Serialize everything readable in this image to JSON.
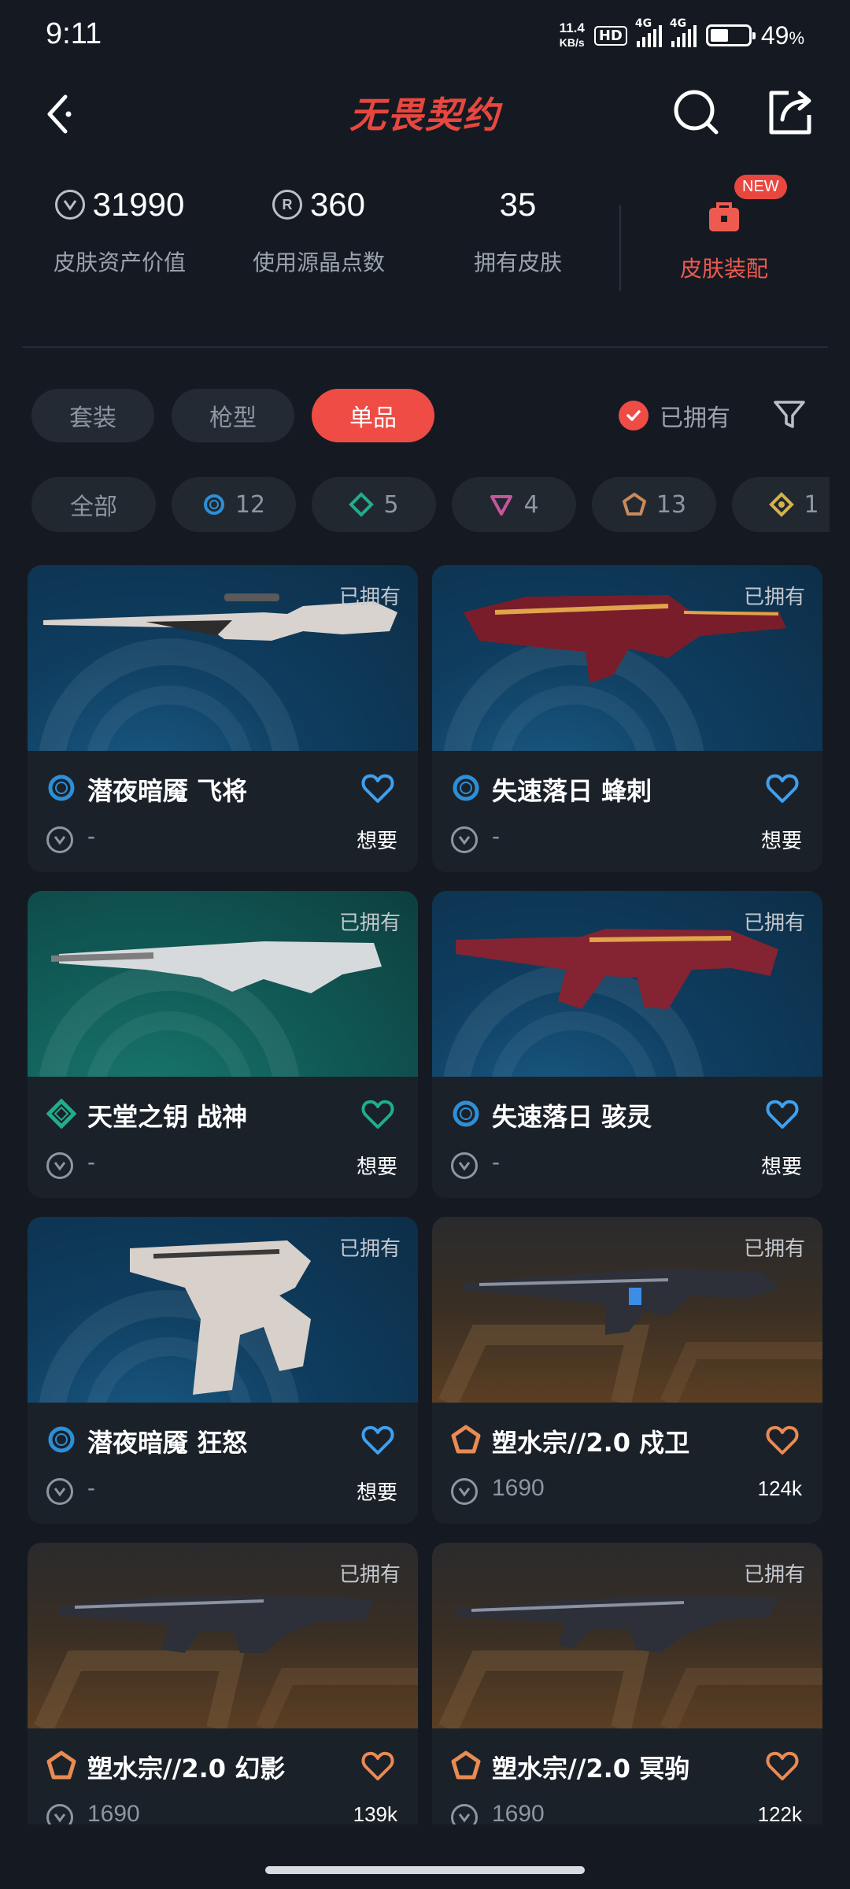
{
  "status_bar": {
    "time": "9:11",
    "net_speed_value": "11.4",
    "net_speed_unit": "KB/s",
    "hd_badge": "HD",
    "signal_tag_1": "4G",
    "signal_tag_2": "4G",
    "battery_level": 49,
    "battery_text": "49",
    "battery_unit": "%"
  },
  "header": {
    "title": "无畏契约",
    "back_icon": "chevron-left-icon",
    "search_icon": "search-icon",
    "share_icon": "share-icon"
  },
  "stats": {
    "asset_value": "31990",
    "asset_label": "皮肤资产价值",
    "radianite_value": "360",
    "radianite_label": "使用源晶点数",
    "skins_value": "35",
    "skins_label": "拥有皮肤",
    "loadout_badge": "NEW",
    "loadout_label": "皮肤装配",
    "loadout_icon": "toolbox-icon"
  },
  "tabs": [
    {
      "label": "套装",
      "active": false
    },
    {
      "label": "枪型",
      "active": false
    },
    {
      "label": "单品",
      "active": true
    }
  ],
  "owned_filter": {
    "label": "已拥有",
    "checked": true
  },
  "tier_chips": [
    {
      "label": "全部",
      "icon": "",
      "color": ""
    },
    {
      "label": "12",
      "icon": "select-tier-icon",
      "color": "#2e8fd6"
    },
    {
      "label": "5",
      "icon": "deluxe-tier-icon",
      "color": "#1fae8b"
    },
    {
      "label": "4",
      "icon": "exclusive-tier-icon",
      "color": "#c4579b"
    },
    {
      "label": "13",
      "icon": "premium-tier-icon",
      "color": "#c98a5a"
    },
    {
      "label": "1",
      "icon": "ultra-tier-icon",
      "color": "#d6b24a"
    }
  ],
  "cards": [
    {
      "owned": "已拥有",
      "name": "潜夜暗魇 飞将",
      "tier": "select",
      "price": "-",
      "want": "想要",
      "bg": "blue",
      "heart_color": "#3ea0ee"
    },
    {
      "owned": "已拥有",
      "name": "失速落日 蜂刺",
      "tier": "select",
      "price": "-",
      "want": "想要",
      "bg": "blue",
      "heart_color": "#3ea0ee"
    },
    {
      "owned": "已拥有",
      "name": "天堂之钥 战神",
      "tier": "deluxe",
      "price": "-",
      "want": "想要",
      "bg": "teal",
      "heart_color": "#1fae8b"
    },
    {
      "owned": "已拥有",
      "name": "失速落日 骇灵",
      "tier": "select",
      "price": "-",
      "want": "想要",
      "bg": "blue",
      "heart_color": "#3ea0ee"
    },
    {
      "owned": "已拥有",
      "name": "潜夜暗魇 狂怒",
      "tier": "select",
      "price": "-",
      "want": "想要",
      "bg": "blue",
      "heart_color": "#3ea0ee"
    },
    {
      "owned": "已拥有",
      "name": "塑水宗//2.0 戍卫",
      "tier": "premium",
      "price": "1690",
      "want": "124k",
      "bg": "bronze",
      "heart_color": "#e98b52"
    },
    {
      "owned": "已拥有",
      "name": "塑水宗//2.0 幻影",
      "tier": "premium",
      "price": "1690",
      "want": "139k",
      "bg": "bronze",
      "heart_color": "#e98b52"
    },
    {
      "owned": "已拥有",
      "name": "塑水宗//2.0 冥驹",
      "tier": "premium",
      "price": "1690",
      "want": "122k",
      "bg": "bronze",
      "heart_color": "#e98b52"
    }
  ]
}
